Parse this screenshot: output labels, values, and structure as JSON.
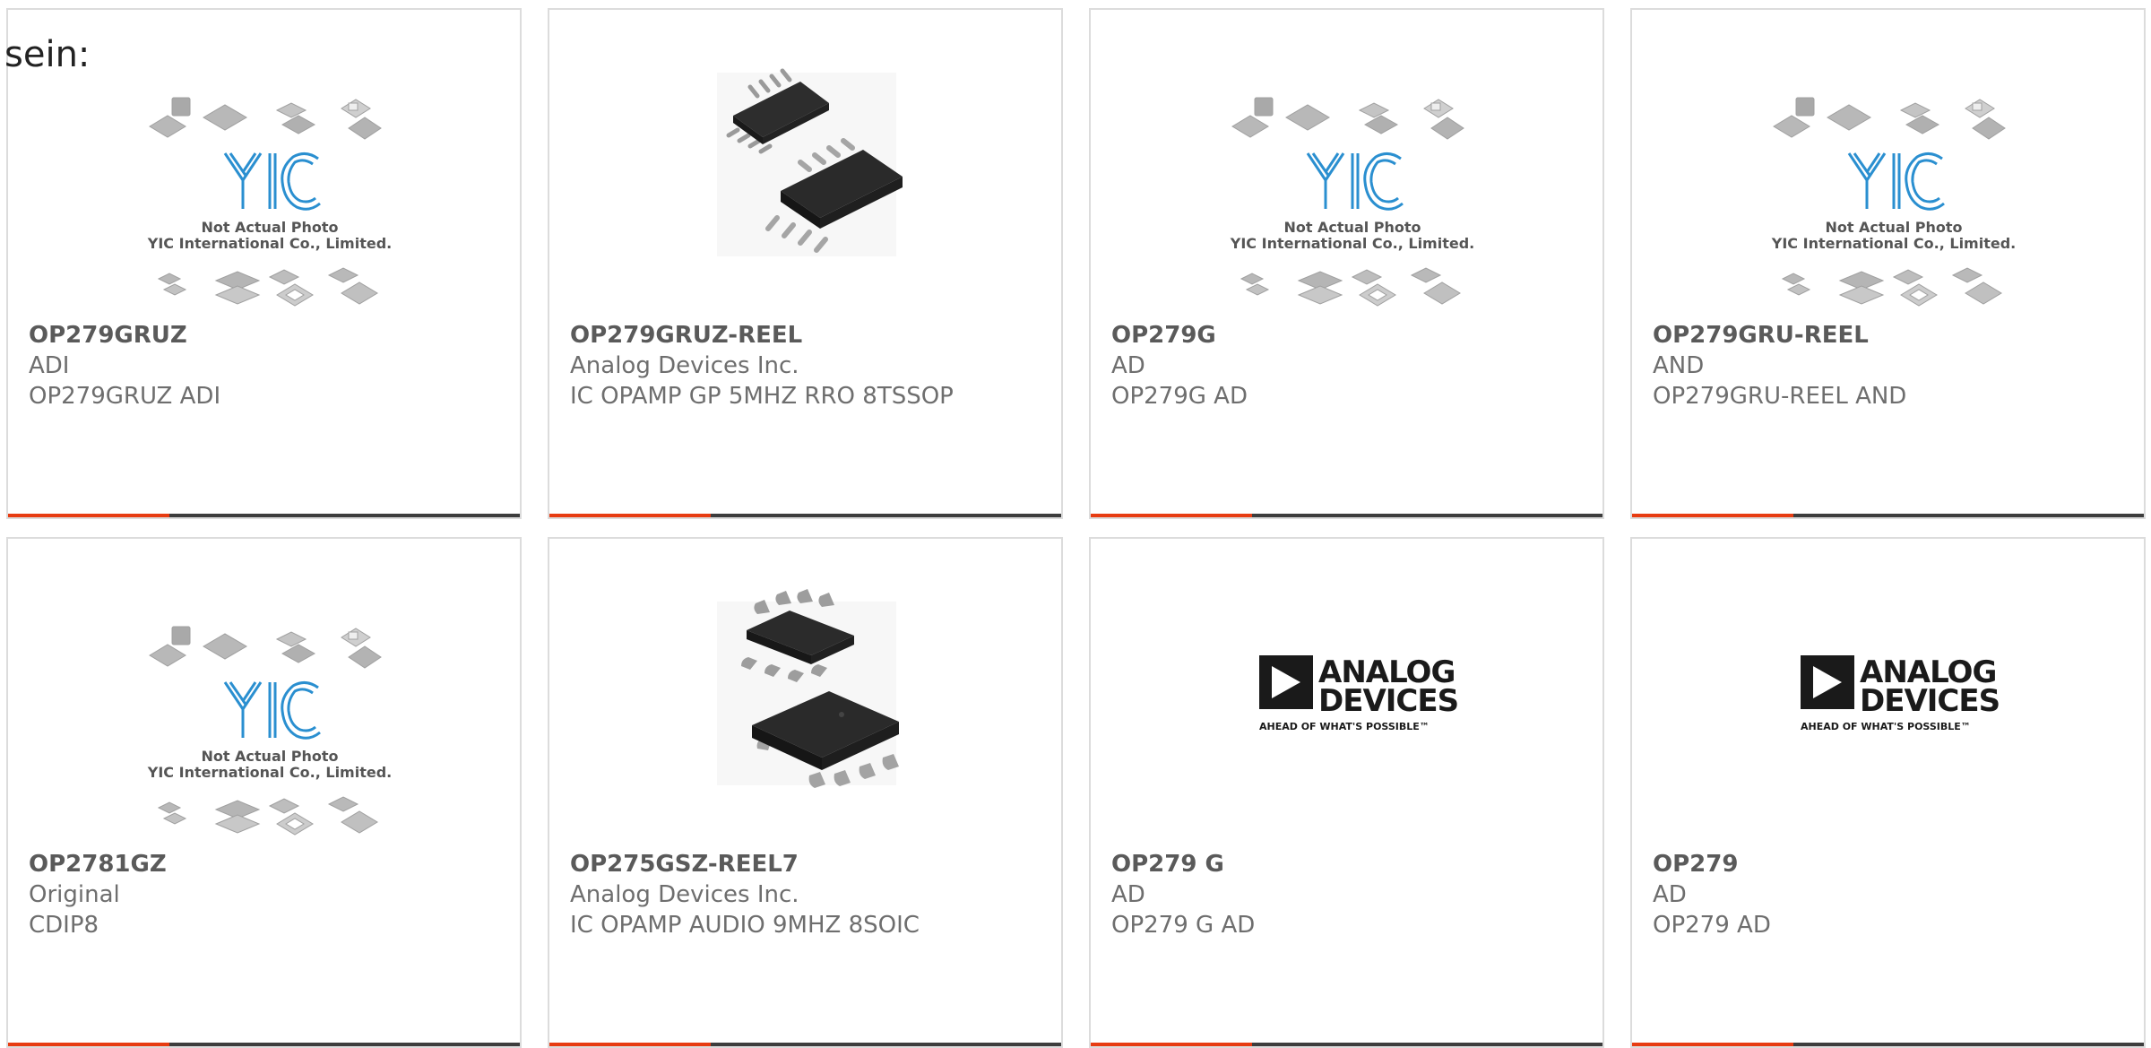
{
  "intro_text": "sein:",
  "colors": {
    "accent": "#e73c12",
    "bar": "#3d3d3d",
    "yic_blue": "#2a8fd0"
  },
  "yic_image": {
    "logo": "YIC",
    "caption_line1": "Not Actual Photo",
    "caption_line2": "YIC International Co., Limited."
  },
  "adi_logo": {
    "line1": "ANALOG",
    "line2": "DEVICES",
    "tagline": "AHEAD OF WHAT'S POSSIBLE™"
  },
  "products": [
    {
      "part": "OP279GRUZ",
      "manufacturer": "ADI",
      "description": "OP279GRUZ ADI",
      "image": "yic-placeholder-icon"
    },
    {
      "part": "OP279GRUZ-REEL",
      "manufacturer": "Analog Devices Inc.",
      "description": "IC OPAMP GP 5MHZ RRO 8TSSOP",
      "image": "tssop-chip-icon"
    },
    {
      "part": "OP279G",
      "manufacturer": "AD",
      "description": "OP279G AD",
      "image": "yic-placeholder-icon"
    },
    {
      "part": "OP279GRU-REEL",
      "manufacturer": "AND",
      "description": "OP279GRU-REEL AND",
      "image": "yic-placeholder-icon"
    },
    {
      "part": "OP2781GZ",
      "manufacturer": "Original",
      "description": "CDIP8",
      "image": "yic-placeholder-icon"
    },
    {
      "part": "OP275GSZ-REEL7",
      "manufacturer": "Analog Devices Inc.",
      "description": "IC OPAMP AUDIO 9MHZ 8SOIC",
      "image": "soic-chip-icon"
    },
    {
      "part": "OP279 G",
      "manufacturer": "AD",
      "description": "OP279 G AD",
      "image": "analog-devices-logo"
    },
    {
      "part": "OP279",
      "manufacturer": "AD",
      "description": "OP279 AD",
      "image": "analog-devices-logo"
    }
  ]
}
